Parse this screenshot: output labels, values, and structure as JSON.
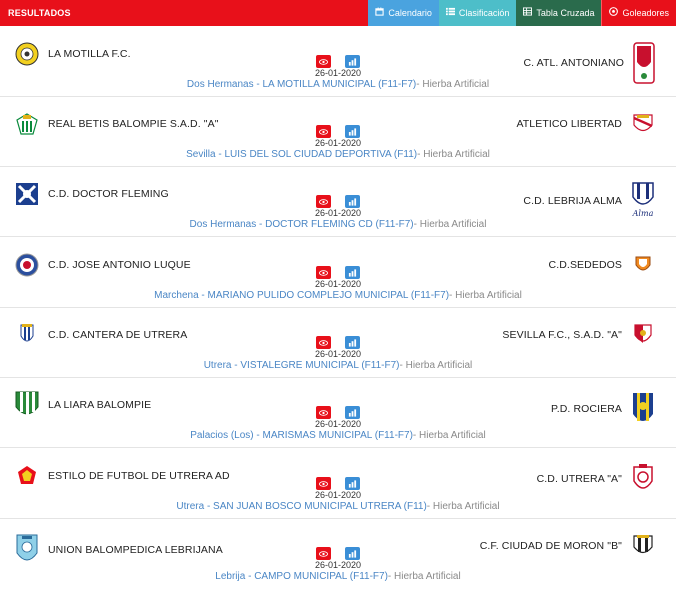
{
  "header": {
    "title": "RESULTADOS",
    "buttons": [
      {
        "label": "Calendario",
        "icon": "calendar-icon"
      },
      {
        "label": "Clasificación",
        "icon": "list-icon"
      },
      {
        "label": "Tabla Cruzada",
        "icon": "table-icon"
      },
      {
        "label": "Goleadores",
        "icon": "soccer-ball-icon"
      }
    ]
  },
  "matches": [
    {
      "home": "LA MOTILLA F.C.",
      "away": "C. ATL. ANTONIANO",
      "date": "26-01-2020",
      "venue": "Dos Hermanas - LA MOTILLA MUNICIPAL (F11-F7)",
      "surface": "- Hierba Artificial"
    },
    {
      "home": "REAL BETIS BALOMPIE S.A.D. \"A\"",
      "away": "ATLETICO LIBERTAD",
      "date": "26-01-2020",
      "venue": "Sevilla - LUIS DEL SOL CIUDAD DEPORTIVA (F11)",
      "surface": "- Hierba Artificial"
    },
    {
      "home": "C.D. DOCTOR FLEMING",
      "away": "C.D. LEBRIJA ALMA",
      "date": "26-01-2020",
      "venue": "Dos Hermanas - DOCTOR FLEMING CD (F11-F7)",
      "surface": "- Hierba Artificial"
    },
    {
      "home": "C.D. JOSE ANTONIO LUQUE",
      "away": "C.D.SEDEDOS",
      "date": "26-01-2020",
      "venue": "Marchena - MARIANO PULIDO COMPLEJO MUNICIPAL (F11-F7)",
      "surface": "- Hierba Artificial"
    },
    {
      "home": "C.D. CANTERA DE UTRERA",
      "away": "SEVILLA F.C., S.A.D. \"A\"",
      "date": "26-01-2020",
      "venue": "Utrera - VISTALEGRE MUNICIPAL (F11-F7)",
      "surface": "- Hierba Artificial"
    },
    {
      "home": "LA LIARA BALOMPIE",
      "away": "P.D. ROCIERA",
      "date": "26-01-2020",
      "venue": "Palacios (Los) - MARISMAS MUNICIPAL (F11-F7)",
      "surface": "- Hierba Artificial"
    },
    {
      "home": "ESTILO DE FUTBOL DE UTRERA AD",
      "away": "C.D. UTRERA \"A\"",
      "date": "26-01-2020",
      "venue": "Utrera - SAN JUAN BOSCO MUNICIPAL UTRERA (F11)",
      "surface": "- Hierba Artificial"
    },
    {
      "home": "UNION BALOMPEDICA LEBRIJANA",
      "away": "C.F. CIUDAD DE MORON \"B\"",
      "date": "26-01-2020",
      "venue": "Lebrija - CAMPO MUNICIPAL (F11-F7)",
      "surface": "- Hierba Artificial"
    }
  ],
  "icons": {
    "view": "eye-icon",
    "stats": "bar-chart-icon"
  },
  "colors": {
    "accent": "#e8101a",
    "link": "#4a86c5",
    "calendar": "#4aa3df",
    "classification": "#4dbec9",
    "crosstable": "#2a6b4c"
  }
}
